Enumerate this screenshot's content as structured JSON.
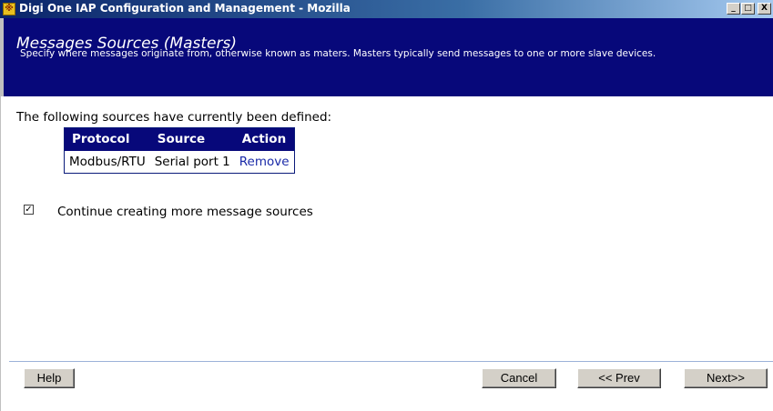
{
  "window": {
    "title": "Digi One IAP Configuration and Management - Mozilla",
    "icon": "app-icon",
    "controls": {
      "minimize": "_",
      "maximize": "□",
      "close": "X"
    }
  },
  "header": {
    "title": "Messages Sources (Masters)",
    "description": "Specify where messages originate from, otherwise known as maters. Masters typically send messages to one or more slave devices."
  },
  "main": {
    "intro": "The following sources have currently been defined:",
    "table": {
      "columns": [
        "Protocol",
        "Source",
        "Action"
      ],
      "rows": [
        {
          "protocol": "Modbus/RTU",
          "source": "Serial port 1",
          "action": "Remove"
        }
      ]
    },
    "continue_checkbox": {
      "checked": true,
      "mark": "✓",
      "label": "Continue creating more message sources"
    }
  },
  "footer": {
    "help_label": "Help",
    "cancel_label": "Cancel",
    "prev_label": "<< Prev",
    "next_label": "Next>>"
  },
  "colors": {
    "header_bg": "#07087a",
    "title_bar": "#0a246a",
    "link": "#1a2aa8"
  }
}
